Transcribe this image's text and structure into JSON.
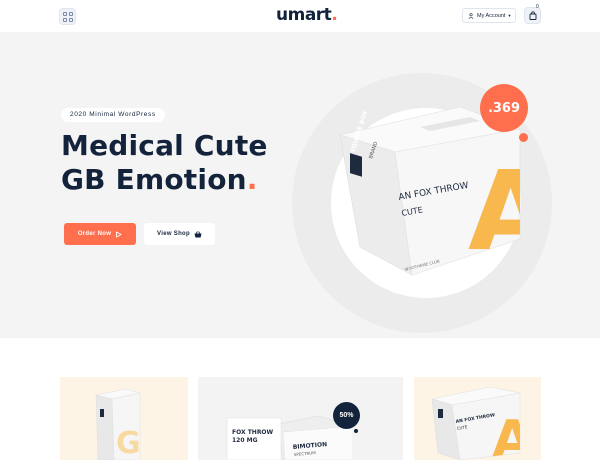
{
  "header": {
    "logo_text": "umart",
    "logo_dot": ".",
    "account_label": "My Account",
    "cart_count": "0",
    "icons": {
      "menu": "grid-icon",
      "user": "user-icon",
      "caret": "chevron-down-icon",
      "cart": "bag-icon"
    }
  },
  "hero": {
    "eyebrow": "2020 Minimal WordPress",
    "title_line1": "Medical Cute",
    "title_line2": "GB Emotion",
    "title_dot": ".",
    "order_button": "Order Now",
    "view_button": "View Shop",
    "price_badge": ".369",
    "box": {
      "side_title": "SQUARE BOX",
      "side_sub": "BRAND",
      "front_title": "AN FOX THROW",
      "front_sub": "CUTE",
      "letter": "A",
      "footer": "WOOTHEME CLUB"
    }
  },
  "cards": [
    {
      "letter": "G"
    },
    {
      "front_title": "FOX THROW",
      "front_sub": "120 MG",
      "back_title": "BIMOTION",
      "back_sub": "SPECTRUM",
      "discount": "50%"
    },
    {
      "front_title": "AN FOX THROW",
      "front_sub": "CUTE",
      "letter": "A"
    }
  ],
  "colors": {
    "accent": "#ff6f4e",
    "navy": "#14233c",
    "box_yellow": "#f8b84e",
    "hero_bg": "#f4f4f4",
    "card_cream": "#fdf4e6"
  }
}
